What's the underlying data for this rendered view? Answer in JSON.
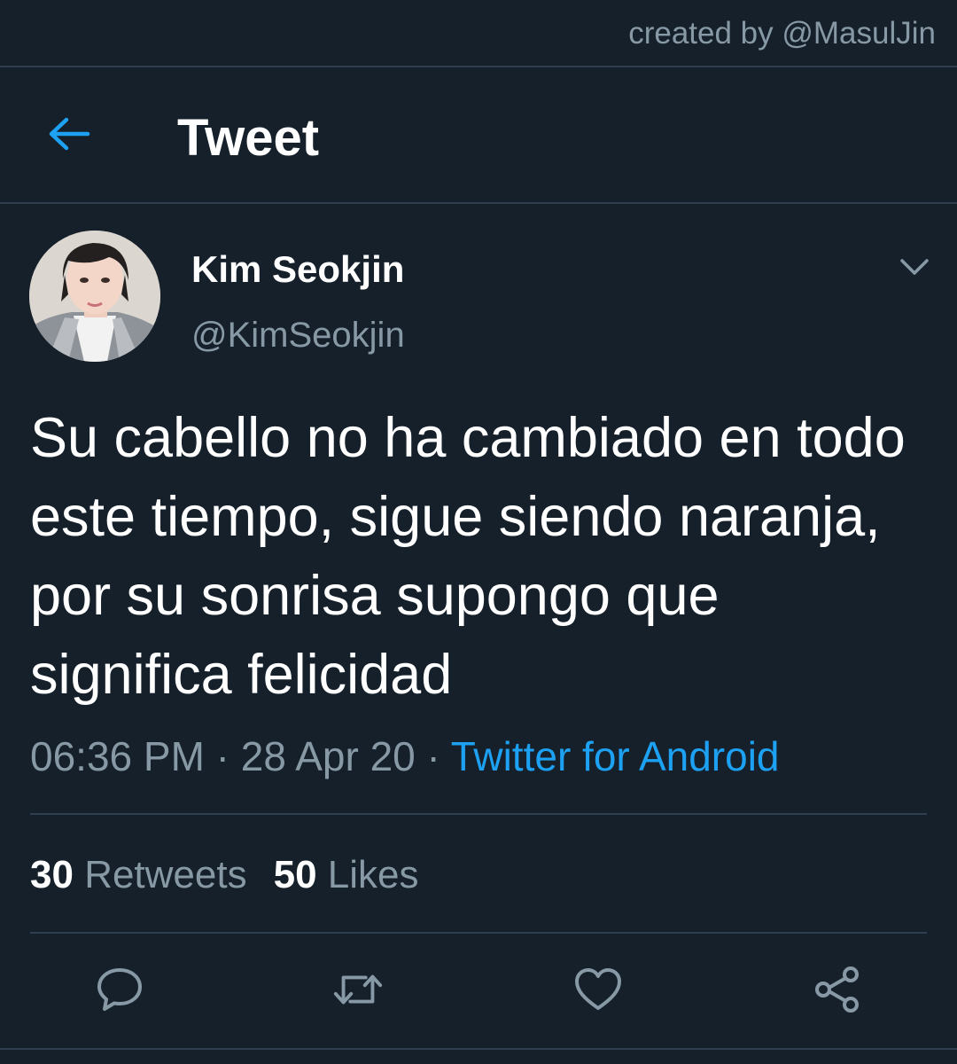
{
  "watermark": "created by @MasulJin",
  "header": {
    "back_icon": "arrow-left-icon",
    "title": "Tweet"
  },
  "author": {
    "name": "Kim Seokjin",
    "handle": "@KimSeokjin"
  },
  "tweet": {
    "text": "Su cabello no ha cambiado en todo este tiempo, sigue siendo naranja, por su sonrisa supongo que significa felicidad",
    "time": "06:36 PM",
    "date": "28 Apr 20",
    "separator": " · ",
    "source": "Twitter for Android"
  },
  "stats": {
    "retweets_count": "30",
    "retweets_label": "Retweets",
    "likes_count": "50",
    "likes_label": "Likes"
  },
  "actions": [
    "reply-icon",
    "retweet-icon",
    "like-icon",
    "share-icon"
  ],
  "colors": {
    "background": "#15202b",
    "accent": "#1da1f2",
    "muted": "#8899a6",
    "divider": "#2f3f4f"
  }
}
